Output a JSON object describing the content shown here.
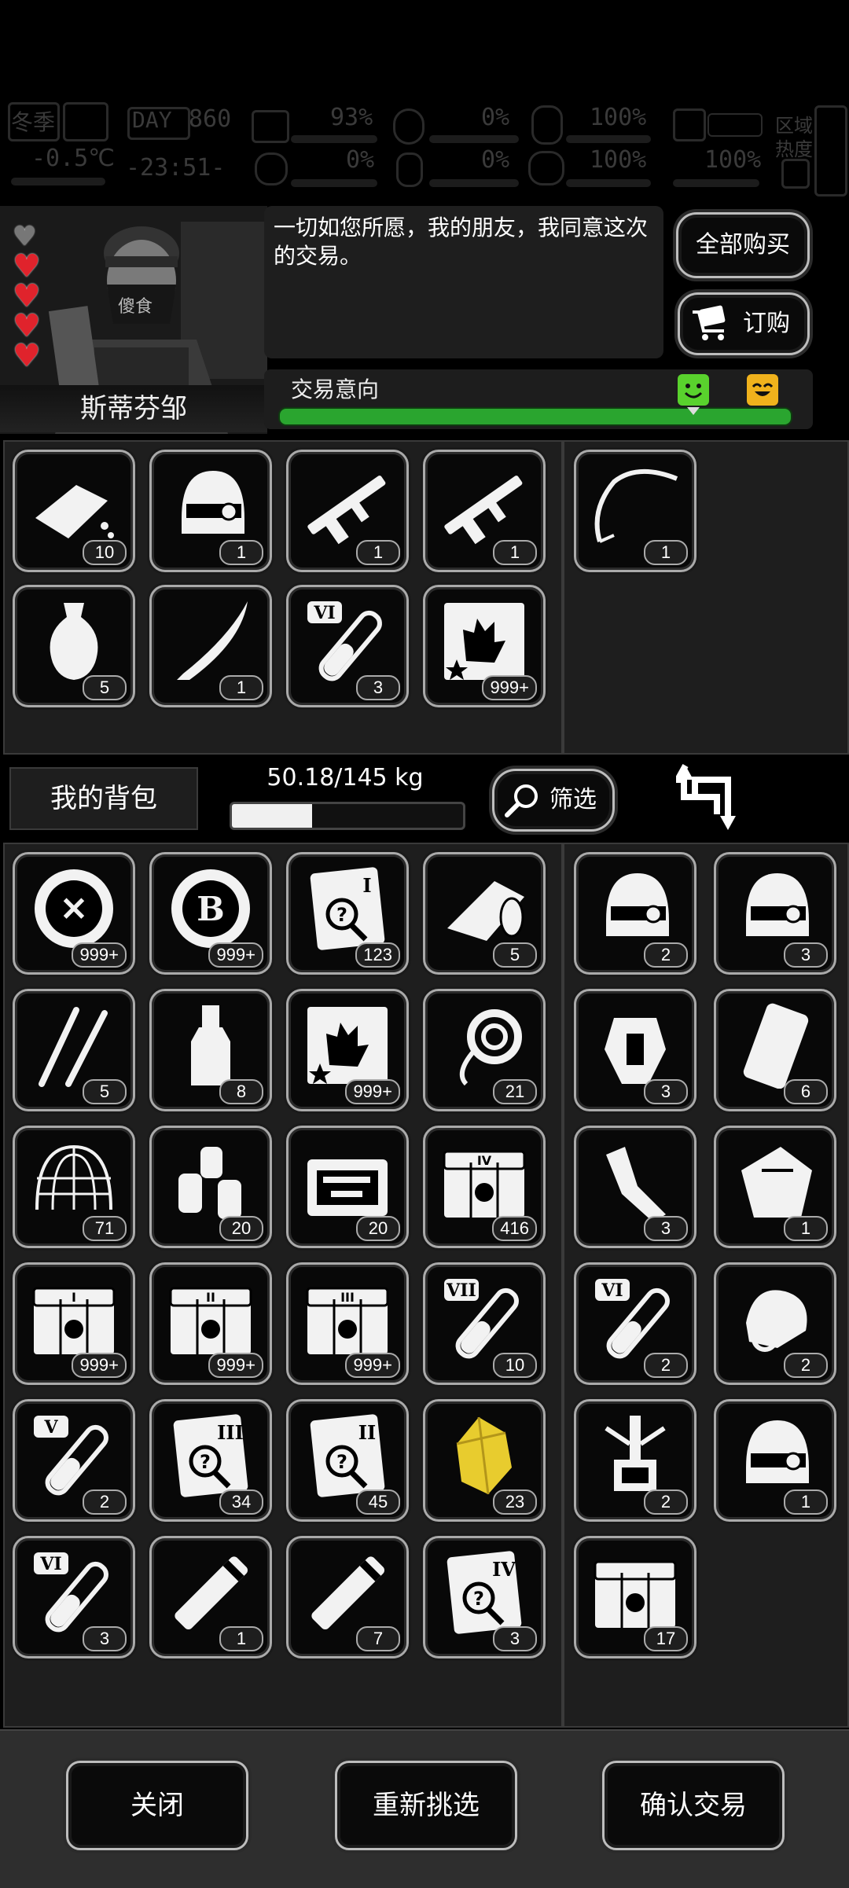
{
  "hud": {
    "season": "冬季",
    "day_label": "DAY",
    "day_value": "860",
    "temperature": "-0.5℃",
    "time": "-23:51-",
    "health_pct": "93%",
    "stat2_pct": "0%",
    "stat3_pct": "0%",
    "stat4_pct": "0%",
    "stat5_pct": "100%",
    "stat6_pct": "100%",
    "stat7_pct": "100%",
    "stat8_pct": "100%",
    "region_label": "区域",
    "heat_label": "热度"
  },
  "npc": {
    "name": "斯蒂芬邹",
    "hearts_filled": 4,
    "hearts_total": 5,
    "speech": "一切如您所愿，我的朋友，我同意这次的交易。"
  },
  "buttons": {
    "buy_all": "全部购买",
    "order": "订购",
    "filter": "筛选",
    "close": "关闭",
    "reselect": "重新挑选",
    "confirm": "确认交易"
  },
  "trade": {
    "label": "交易意向",
    "intent_fraction": 1.0
  },
  "backpack": {
    "label": "我的背包",
    "weight": "50.18/145 kg",
    "weight_fraction": 0.346
  },
  "merchant_items": [
    {
      "icon": "bread-icon",
      "qty": "10"
    },
    {
      "icon": "helmet-hood-icon",
      "qty": "1"
    },
    {
      "icon": "shotgun-icon",
      "qty": "1"
    },
    {
      "icon": "grenade-launcher-icon",
      "qty": "1"
    },
    {
      "icon": "vase-icon",
      "qty": "5"
    },
    {
      "icon": "katana-icon",
      "qty": "1"
    },
    {
      "icon": "potion-vi-icon",
      "qty": "3"
    },
    {
      "icon": "zombie-card-icon",
      "qty": "999+"
    }
  ],
  "merchant_side_items": [
    {
      "icon": "bow-icon",
      "qty": "1"
    }
  ],
  "bag_items": [
    {
      "icon": "tool-coin-icon",
      "qty": "999+"
    },
    {
      "icon": "bitcoin-icon",
      "qty": "999+"
    },
    {
      "icon": "unknown-map-i-icon",
      "qty": "123"
    },
    {
      "icon": "cloth-roll-icon",
      "qty": "5"
    },
    {
      "icon": "lockpick-icon",
      "qty": "5"
    },
    {
      "icon": "bottle-icon",
      "qty": "8"
    },
    {
      "icon": "zombie-card-icon",
      "qty": "999+"
    },
    {
      "icon": "rope-icon",
      "qty": "21"
    },
    {
      "icon": "net-icon",
      "qty": "71"
    },
    {
      "icon": "gas-bottles-icon",
      "qty": "20"
    },
    {
      "icon": "toolbox-icon",
      "qty": "20"
    },
    {
      "icon": "crate-iv-icon",
      "qty": "416"
    },
    {
      "icon": "crate-i-icon",
      "qty": "999+"
    },
    {
      "icon": "crate-ii-icon",
      "qty": "999+"
    },
    {
      "icon": "crate-iii-icon",
      "qty": "999+"
    },
    {
      "icon": "potion-vii-icon",
      "qty": "10"
    },
    {
      "icon": "potion-v-icon",
      "qty": "2"
    },
    {
      "icon": "unknown-map-iii-icon",
      "qty": "34"
    },
    {
      "icon": "unknown-map-ii-icon",
      "qty": "45"
    },
    {
      "icon": "gold-crystal-icon",
      "qty": "23"
    },
    {
      "icon": "potion-vi-icon",
      "qty": "3"
    },
    {
      "icon": "tube-icon",
      "qty": "1"
    },
    {
      "icon": "tube-icon",
      "qty": "7"
    },
    {
      "icon": "unknown-map-iv-icon",
      "qty": "3"
    }
  ],
  "bag_side_items": [
    {
      "icon": "cyber-helmet-icon",
      "qty": "2"
    },
    {
      "icon": "tactical-helmet-icon",
      "qty": "3"
    },
    {
      "icon": "robot-torso-icon",
      "qty": "3"
    },
    {
      "icon": "armor-plate-icon",
      "qty": "6"
    },
    {
      "icon": "robot-arm-icon",
      "qty": "3"
    },
    {
      "icon": "gauntlet-icon",
      "qty": "1"
    },
    {
      "icon": "potion-vi-icon",
      "qty": "2"
    },
    {
      "icon": "mask-icon",
      "qty": "2"
    },
    {
      "icon": "robot-legs-icon",
      "qty": "2"
    },
    {
      "icon": "combat-helmet-icon",
      "qty": "1"
    },
    {
      "icon": "money-crate-icon",
      "qty": "17"
    }
  ]
}
